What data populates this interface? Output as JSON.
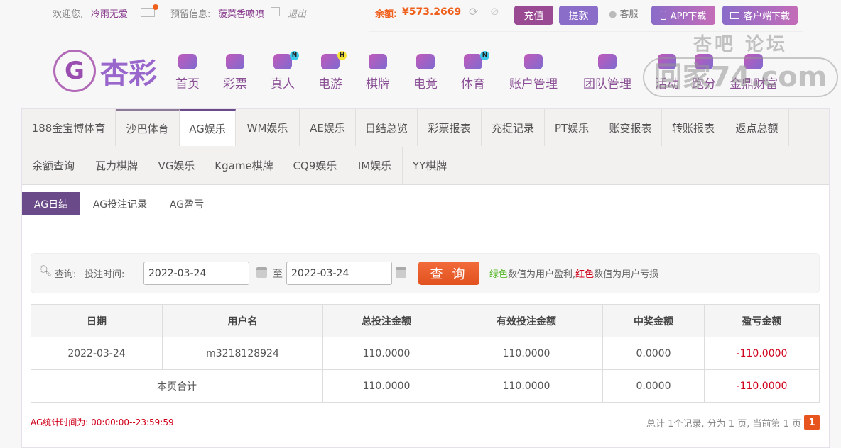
{
  "topbar": {
    "welcome": "欢迎您,",
    "username": "冷雨无爱",
    "reserved_label": "预留信息:",
    "reserved_value": "菠菜香喷喷",
    "logout": "退出",
    "balance_label": "余额:",
    "balance_value": "¥573.2669",
    "recharge": "充值",
    "withdraw": "提款",
    "service": "客服",
    "app_download": "APP下载",
    "client_download": "客户端下载"
  },
  "logo": {
    "text": "杏彩"
  },
  "nav": [
    {
      "label": "首页"
    },
    {
      "label": "彩票"
    },
    {
      "label": "真人",
      "badge": "N"
    },
    {
      "label": "电游",
      "badge": "H"
    },
    {
      "label": "棋牌"
    },
    {
      "label": "电竞"
    },
    {
      "label": "体育",
      "badge": "N"
    },
    {
      "label": "账户管理"
    },
    {
      "label": "团队管理"
    },
    {
      "label": "活动"
    },
    {
      "label": "跑分"
    },
    {
      "label": "金鼎财富"
    }
  ],
  "watermark": {
    "line1": "杏吧 论坛",
    "line2": "回家74.com"
  },
  "tabs_row1": [
    "188金宝博体育",
    "沙巴体育",
    "AG娱乐",
    "WM娱乐",
    "AE娱乐",
    "日结总览",
    "彩票报表",
    "充提记录",
    "PT娱乐",
    "账变报表",
    "转账报表",
    "返点总额"
  ],
  "tabs_row2": [
    "余额查询",
    "瓦力棋牌",
    "VG娱乐",
    "Kgame棋牌",
    "CQ9娱乐",
    "IM娱乐",
    "YY棋牌"
  ],
  "active_tab": "AG娱乐",
  "subtabs": [
    "AG日结",
    "AG投注记录",
    "AG盈亏"
  ],
  "search": {
    "query_label": "查询:",
    "time_label": "投注时间:",
    "start_date": "2022-03-24",
    "to": "至",
    "end_date": "2022-03-24",
    "button": "查 询",
    "hint_green": "绿色",
    "hint_mid": "数值为用户盈利,",
    "hint_red": "红色",
    "hint_end": "数值为用户亏损"
  },
  "table": {
    "headers": [
      "日期",
      "用户名",
      "总投注金额",
      "有效投注金额",
      "中奖金额",
      "盈亏金额"
    ],
    "rows": [
      [
        "2022-03-24",
        "m3218128924",
        "110.0000",
        "110.0000",
        "0.0000",
        "-110.0000"
      ]
    ],
    "total": {
      "label": "本页合计",
      "bet": "110.0000",
      "valid": "110.0000",
      "win": "0.0000",
      "pl": "-110.0000"
    }
  },
  "footer": {
    "stat_time": "AG统计时间为: 00:00:00--23:59:59",
    "pagination": "总计 1个记录, 分为 1 页, 当前第 1 页",
    "current_page": "1"
  },
  "colors": {
    "accent": "#6b4a8a",
    "query": "#e8541e",
    "negative": "#d0021b"
  }
}
